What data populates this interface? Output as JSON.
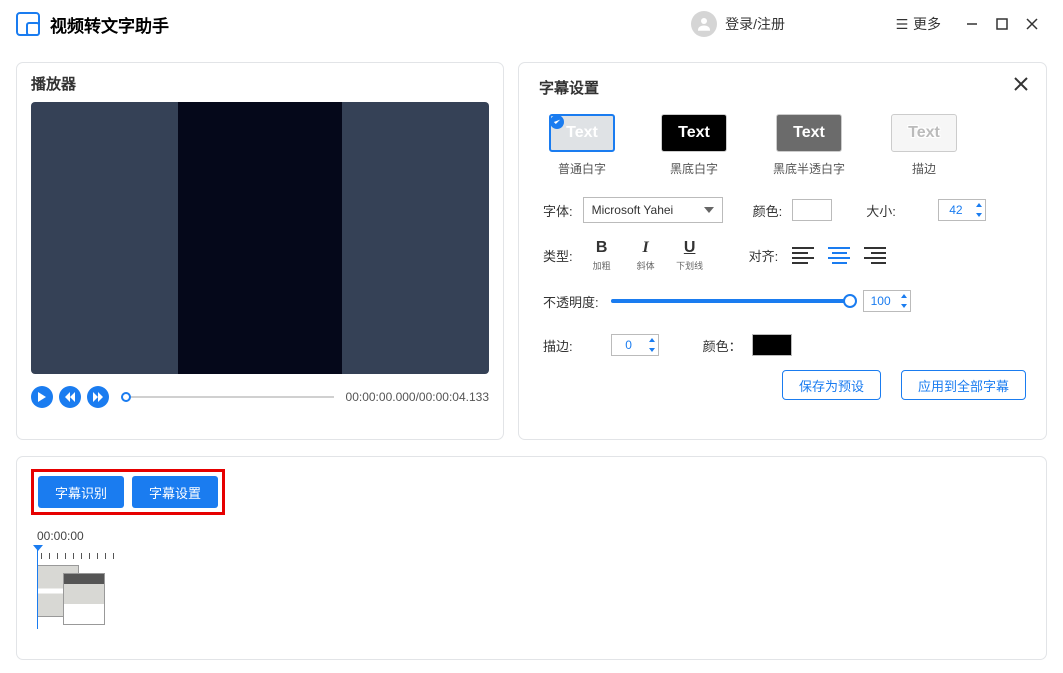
{
  "titlebar": {
    "app_title": "视频转文字助手",
    "login_text": "登录/注册",
    "more_text": "更多"
  },
  "player": {
    "title": "播放器",
    "timecode": "00:00:00.000/00:00:04.133"
  },
  "settings": {
    "title": "字幕设置",
    "styles": [
      {
        "label": "普通白字",
        "text": "Text"
      },
      {
        "label": "黑底白字",
        "text": "Text"
      },
      {
        "label": "黑底半透白字",
        "text": "Text"
      },
      {
        "label": "描边",
        "text": "Text"
      }
    ],
    "font_label": "字体:",
    "font_value": "Microsoft Yahei",
    "color_label": "颜色:",
    "size_label": "大小:",
    "size_value": "42",
    "type_label": "类型:",
    "type_bold": "B",
    "type_bold_t": "加粗",
    "type_italic": "I",
    "type_italic_t": "斜体",
    "type_under": "U",
    "type_under_t": "下划线",
    "align_label": "对齐:",
    "opacity_label": "不透明度:",
    "opacity_value": "100",
    "stroke_label": "描边:",
    "stroke_value": "0",
    "stroke_color_label": "颜色：",
    "save_preset": "保存为预设",
    "apply_all": "应用到全部字幕"
  },
  "timeline": {
    "tabs": {
      "recognize": "字幕识别",
      "settings": "字幕设置"
    },
    "time": "00:00:00"
  }
}
